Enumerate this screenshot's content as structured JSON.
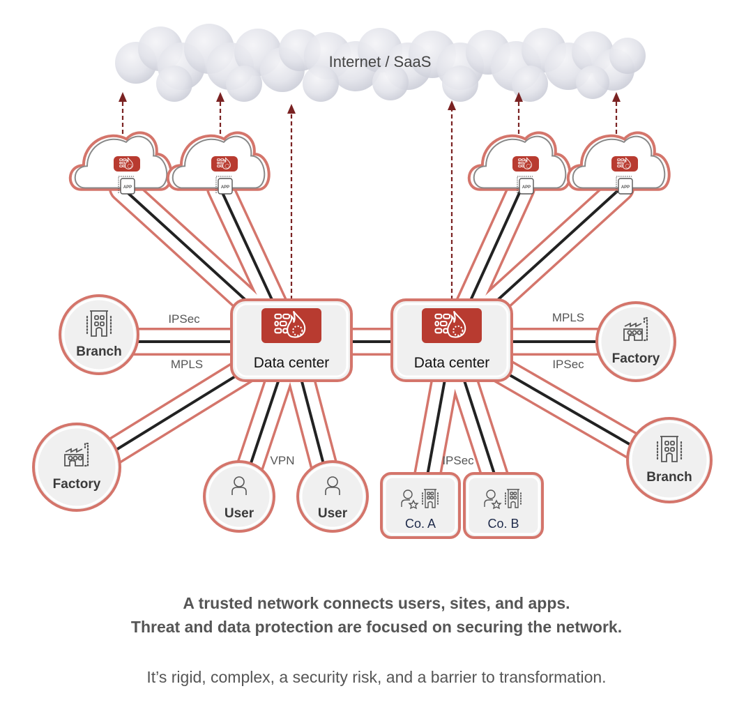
{
  "internet": {
    "label": "Internet / SaaS"
  },
  "colors": {
    "tube_outline": "#d4756b",
    "tube_fill": "#ffffff",
    "line": "#222222",
    "accent": "#b83b30",
    "arrow": "#7a2222",
    "node_fill": "#f0f0f0",
    "node_text": "#3a3a3a",
    "company_text": "#1e2a4a",
    "cloud": "#dcdde5"
  },
  "data_centers": [
    {
      "id": "dc-left",
      "label": "Data center",
      "icon": "firewall-flame-icon"
    },
    {
      "id": "dc-right",
      "label": "Data center",
      "icon": "firewall-flame-icon"
    }
  ],
  "cloud_apps": [
    {
      "id": "cloud-app-1",
      "icons": [
        "firewall-flame-icon",
        "app-icon"
      ],
      "app_label": "APP"
    },
    {
      "id": "cloud-app-2",
      "icons": [
        "firewall-flame-icon",
        "app-icon"
      ],
      "app_label": "APP"
    },
    {
      "id": "cloud-app-3",
      "icons": [
        "firewall-flame-icon",
        "app-icon"
      ],
      "app_label": "APP"
    },
    {
      "id": "cloud-app-4",
      "icons": [
        "firewall-flame-icon",
        "app-icon"
      ],
      "app_label": "APP"
    }
  ],
  "sites": [
    {
      "id": "branch-left",
      "label": "Branch",
      "icon": "building-icon"
    },
    {
      "id": "factory-left",
      "label": "Factory",
      "icon": "factory-icon"
    },
    {
      "id": "user-1",
      "label": "User",
      "icon": "user-icon"
    },
    {
      "id": "user-2",
      "label": "User",
      "icon": "user-icon"
    },
    {
      "id": "company-a",
      "label": "Co. A",
      "icon": "partner-building-icon"
    },
    {
      "id": "company-b",
      "label": "Co. B",
      "icon": "partner-building-icon"
    },
    {
      "id": "factory-right",
      "label": "Factory",
      "icon": "factory-icon"
    },
    {
      "id": "branch-right",
      "label": "Branch",
      "icon": "building-icon"
    }
  ],
  "link_labels": {
    "left_ipsec": "IPSec",
    "left_mpls": "MPLS",
    "vpn": "VPN",
    "partner_ipsec": "IPSec",
    "right_mpls": "MPLS",
    "right_ipsec": "IPSec"
  },
  "captions": {
    "line1": "A trusted network connects users, sites, and apps.",
    "line2": "Threat and data protection are focused on securing the network.",
    "line3": "It’s rigid, complex, a security risk, and a barrier to transformation."
  }
}
